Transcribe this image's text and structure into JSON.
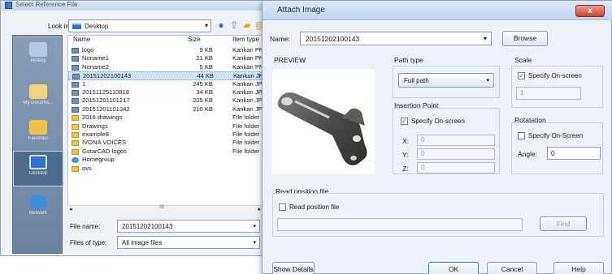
{
  "left_dialog": {
    "title": "Select Reference File",
    "look_in_label": "Look in:",
    "look_in_value": "Desktop",
    "places": [
      {
        "label": "History",
        "icon": "history-icon"
      },
      {
        "label": "My Docume...",
        "icon": "documents-icon"
      },
      {
        "label": "Favorites",
        "icon": "favorites-icon"
      },
      {
        "label": "Desktop",
        "icon": "desktop-icon"
      },
      {
        "label": "Network",
        "icon": "network-icon"
      }
    ],
    "columns": {
      "name": "Name",
      "size": "Size",
      "type": "Item type"
    },
    "files": [
      {
        "name": "logo",
        "size": "9 KB",
        "type": "Kankan PN",
        "icon": "image"
      },
      {
        "name": "Noname1",
        "size": "21 KB",
        "type": "Kankan PN",
        "icon": "image"
      },
      {
        "name": "Noname2",
        "size": "5 KB",
        "type": "Kankan PN",
        "icon": "image"
      },
      {
        "name": "20151202100143",
        "size": "44 KB",
        "type": "Kankan JP",
        "icon": "image"
      },
      {
        "name": "1",
        "size": "245 KB",
        "type": "Kankan JP",
        "icon": "image"
      },
      {
        "name": "20151125110818",
        "size": "34 KB",
        "type": "Kankan JP",
        "icon": "image"
      },
      {
        "name": "20151201101217",
        "size": "205 KB",
        "type": "Kankan JP",
        "icon": "image"
      },
      {
        "name": "20151201101342",
        "size": "210 KB",
        "type": "Kankan JP",
        "icon": "image"
      },
      {
        "name": "2016 drawings",
        "size": "",
        "type": "File folder",
        "icon": "folder"
      },
      {
        "name": "Drawings",
        "size": "",
        "type": "File folder",
        "icon": "folder"
      },
      {
        "name": "example8",
        "size": "",
        "type": "File folder",
        "icon": "folder"
      },
      {
        "name": "IVONA VOICES",
        "size": "",
        "type": "File folder",
        "icon": "folder"
      },
      {
        "name": "GstarCAD logos",
        "size": "",
        "type": "File folder",
        "icon": "folder"
      },
      {
        "name": "Homegroup",
        "size": "",
        "type": "",
        "icon": "home"
      },
      {
        "name": "ovs",
        "size": "",
        "type": "",
        "icon": "folder"
      }
    ],
    "selected_index": 3,
    "scroll_dots": "III",
    "file_name_label": "File name:",
    "file_name_value": "20151202100143",
    "file_type_label": "Files of type:",
    "file_type_value": "All image files"
  },
  "right_dialog": {
    "title": "Attach Image",
    "close_glyph": "x",
    "name_label": "Name:",
    "name_value": "20151202100143",
    "browse_label": "Browse",
    "preview_label": "PREVIEW",
    "path_type_label": "Path type",
    "path_type_value": "Full path",
    "insertion_label": "Insertion Point",
    "insertion_specify": "Specify On-screen",
    "insertion_specify_checked": true,
    "x_label": "X:",
    "x_value": "0",
    "y_label": "Y:",
    "y_value": "0",
    "z_label": "Z:",
    "z_value": "0",
    "scale_label": "Scale",
    "scale_specify": "Specify On-screen",
    "scale_specify_checked": true,
    "scale_value": "1",
    "rotation_label": "Rotatation",
    "rotation_specify": "Specify On-Screen",
    "rotation_specify_checked": false,
    "angle_label": "Angle:",
    "angle_value": "0",
    "read_position_group": "Read position file",
    "read_position_check": "Read position file",
    "read_position_checked": false,
    "find_label": "Find",
    "show_details_label": "Show Details",
    "ok_label": "OK",
    "cancel_label": "Cancel",
    "help_label": "Help"
  }
}
